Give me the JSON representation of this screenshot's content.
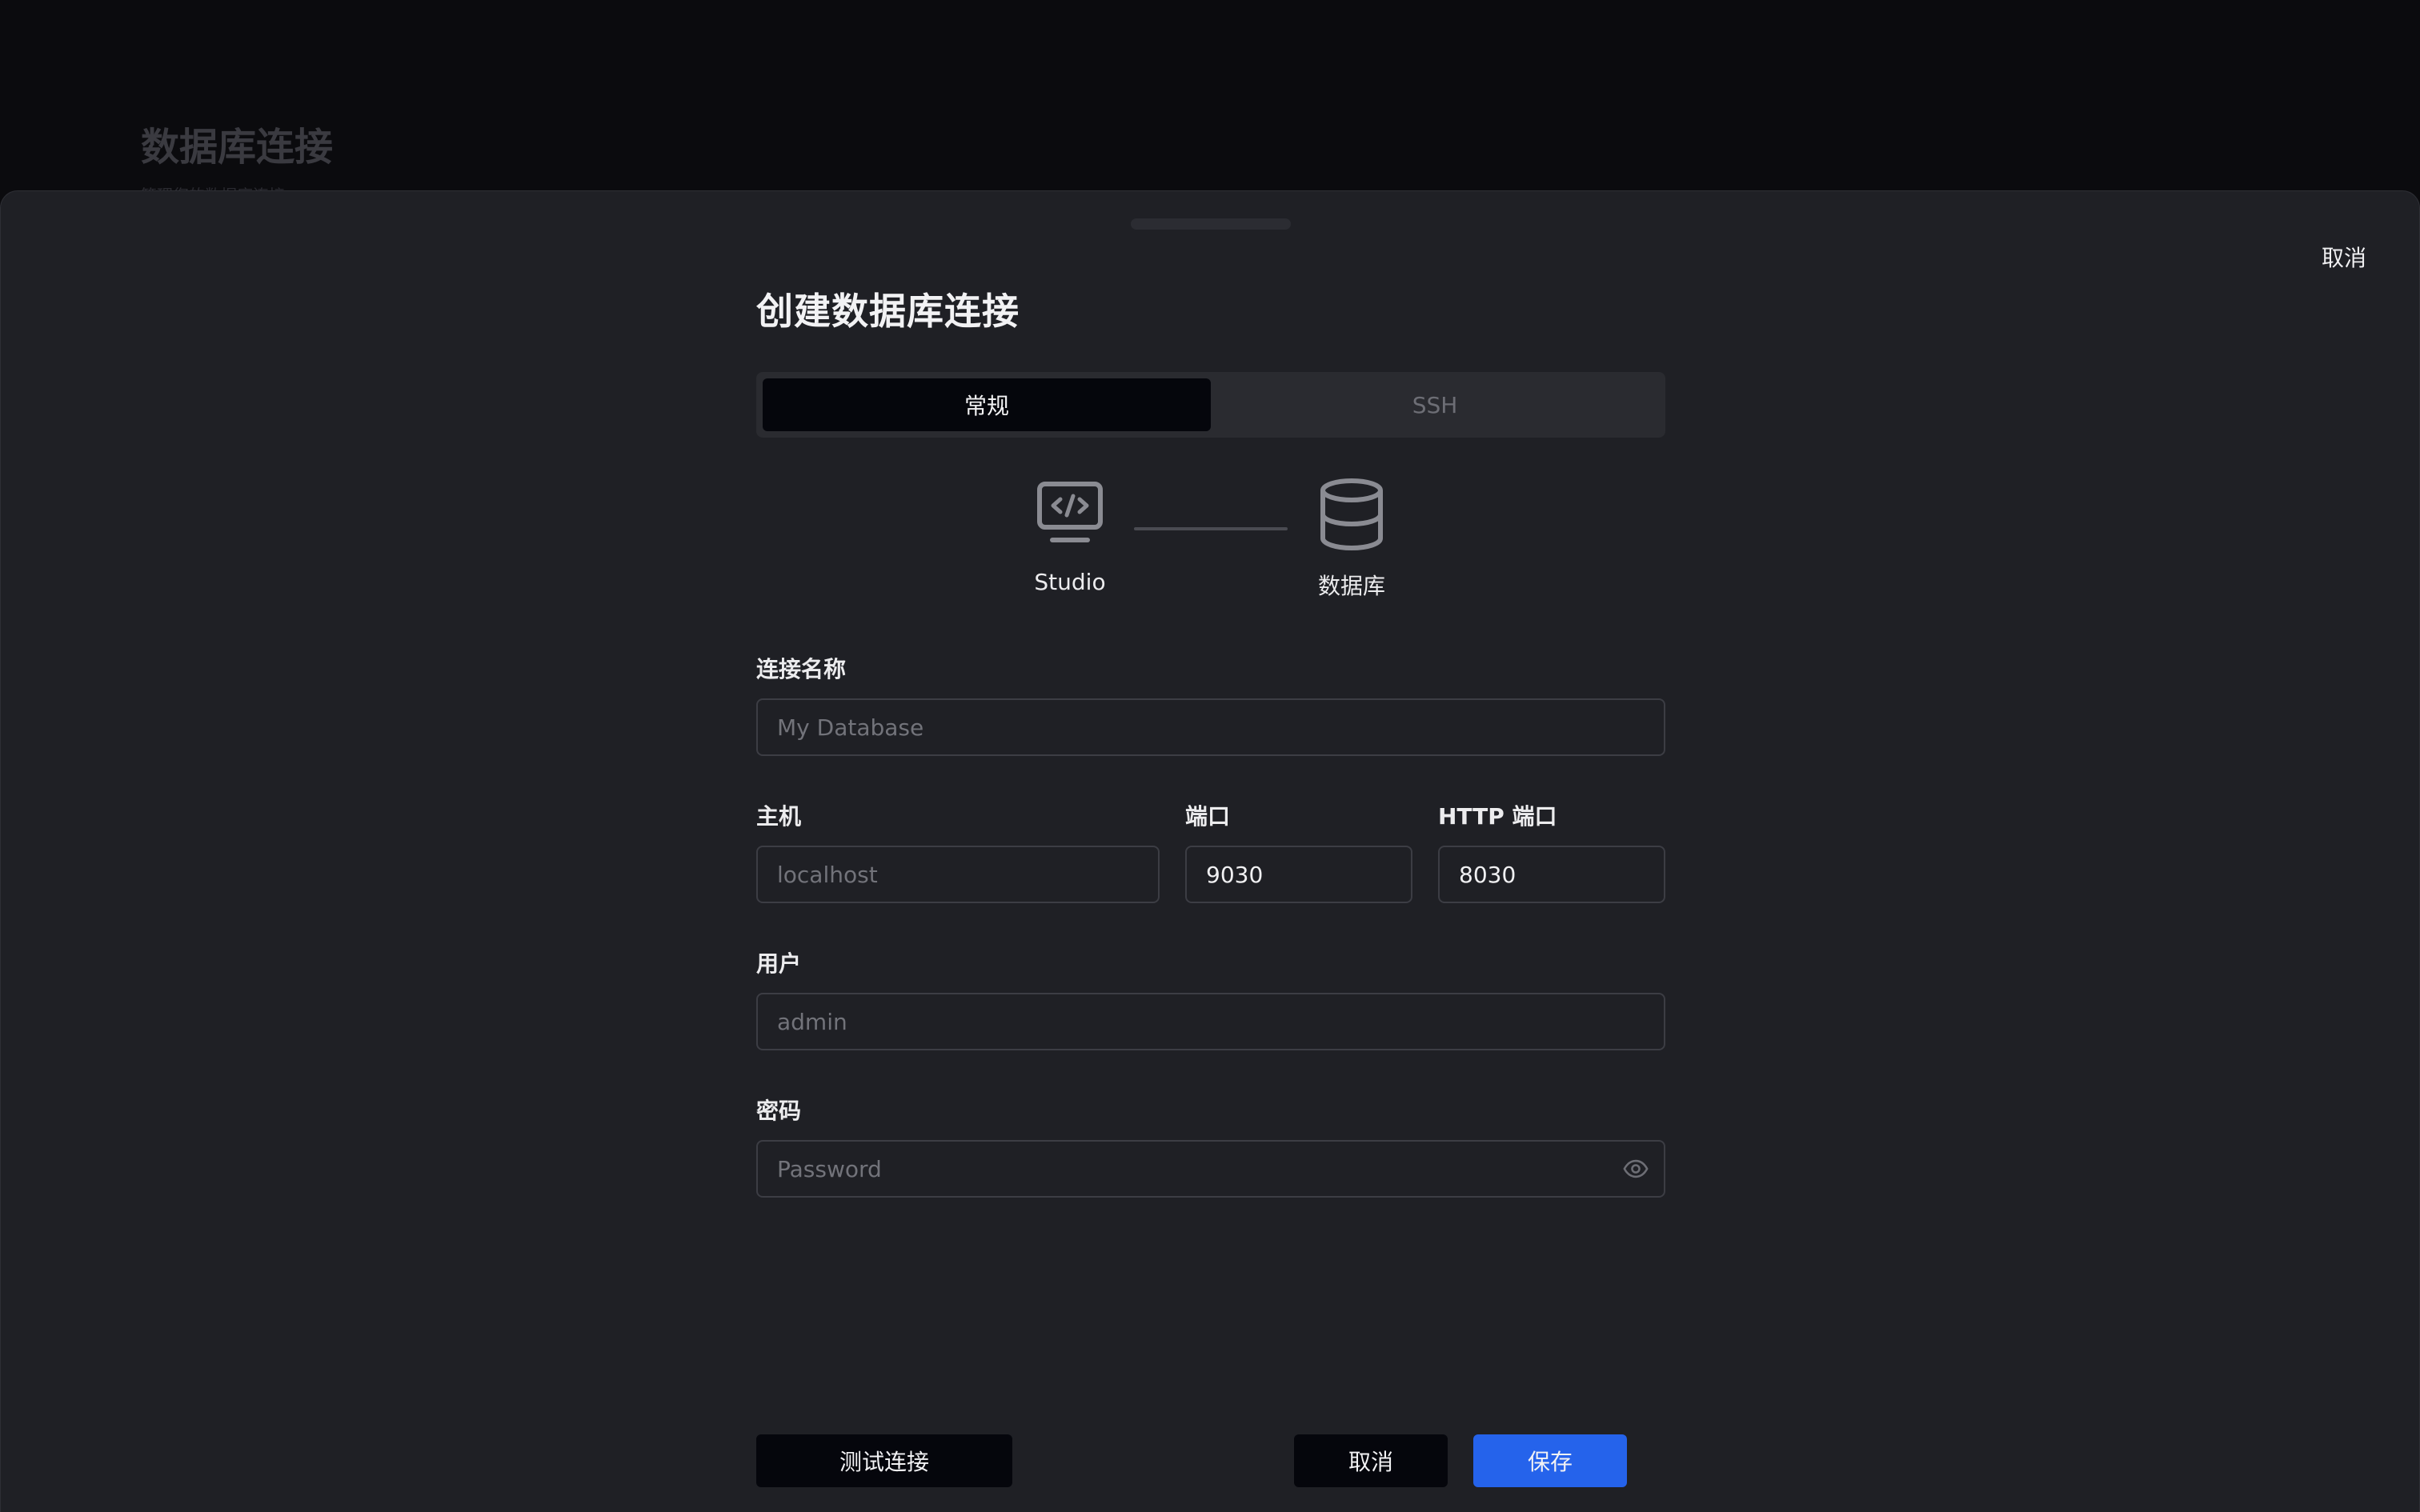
{
  "background": {
    "title": "数据库连接",
    "subtitle": "管理您的数据库连接"
  },
  "sheet": {
    "top_cancel_label": "取消",
    "title": "创建数据库连接",
    "tabs": [
      {
        "label": "常规",
        "active": true
      },
      {
        "label": "SSH",
        "active": false
      }
    ],
    "diagram": {
      "client_label": "Studio",
      "client_icon": "monitor-code-icon",
      "server_label": "数据库",
      "server_icon": "database-icon"
    },
    "fields": {
      "connection_name": {
        "label": "连接名称",
        "placeholder": "My Database",
        "value": ""
      },
      "host": {
        "label": "主机",
        "placeholder": "localhost",
        "value": ""
      },
      "port": {
        "label": "端口",
        "value": "9030"
      },
      "http_port": {
        "label": "HTTP 端口",
        "value": "8030"
      },
      "user": {
        "label": "用户",
        "placeholder": "admin",
        "value": ""
      },
      "password": {
        "label": "密码",
        "placeholder": "Password",
        "value": "",
        "toggle_icon": "eye-icon"
      }
    },
    "buttons": {
      "test": "测试连接",
      "cancel": "取消",
      "save": "保存"
    }
  },
  "colors": {
    "background": "#0b0b0e",
    "sheet": "#1f2025",
    "primary": "#2563eb",
    "dark_button": "#05060c"
  }
}
